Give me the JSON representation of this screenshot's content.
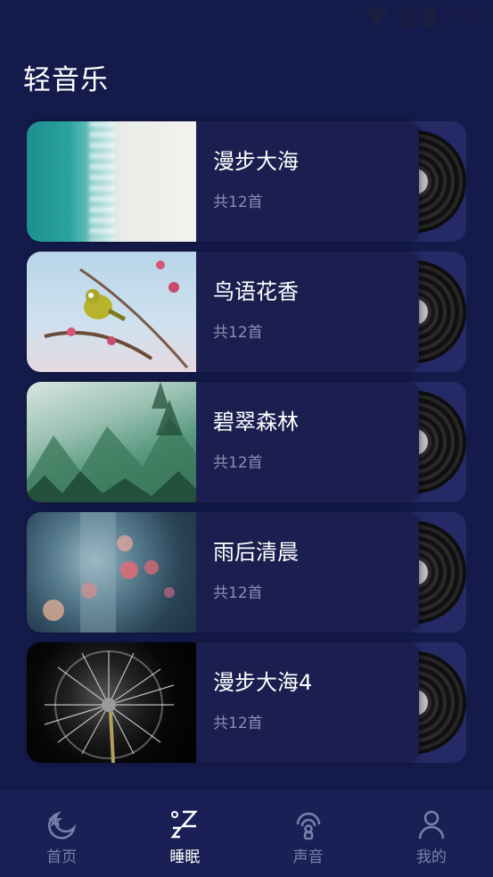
{
  "status": {
    "time": "5:10"
  },
  "page": {
    "title": "轻音乐"
  },
  "albums": [
    {
      "title": "漫步大海",
      "count": "共12首",
      "image": "ocean"
    },
    {
      "title": "鸟语花香",
      "count": "共12首",
      "image": "bird"
    },
    {
      "title": "碧翠森林",
      "count": "共12首",
      "image": "forest"
    },
    {
      "title": "雨后清晨",
      "count": "共12首",
      "image": "rain"
    },
    {
      "title": "漫步大海4",
      "count": "共12首",
      "image": "dandelion"
    }
  ],
  "nav": [
    {
      "label": "首页",
      "icon": "moon-star-icon",
      "active": false
    },
    {
      "label": "睡眠",
      "icon": "sleep-zz-icon",
      "active": true
    },
    {
      "label": "声音",
      "icon": "sound-signal-icon",
      "active": false
    },
    {
      "label": "我的",
      "icon": "person-icon",
      "active": false
    }
  ],
  "colors": {
    "background": "#141a4a",
    "card": "#1b1f4f",
    "nav_bar": "#1a2055",
    "muted_text": "#8a8fb0"
  }
}
